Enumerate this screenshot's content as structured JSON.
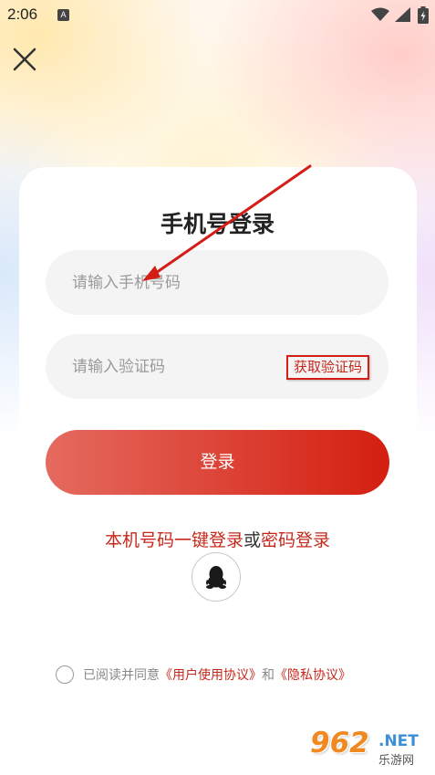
{
  "status_bar": {
    "time": "2:06",
    "notification_icon": "A",
    "icons": [
      "wifi-icon",
      "signal-icon",
      "battery-icon"
    ]
  },
  "header": {
    "close_icon": "close-icon"
  },
  "title": "手机号登录",
  "phone_input": {
    "placeholder": "请输入手机号码",
    "value": ""
  },
  "code_input": {
    "placeholder": "请输入验证码",
    "value": ""
  },
  "get_code_label": "获取验证码",
  "login_button_label": "登录",
  "alt_login": {
    "one_click": "本机号码一键登录",
    "or": "或",
    "password": "密码登录"
  },
  "qq_login_icon": "qq-penguin-icon",
  "agreement": {
    "checked": false,
    "prefix": "已阅读并同意",
    "user_agreement": "《用户使用协议》",
    "and": "和",
    "privacy_agreement": "《隐私协议》"
  },
  "watermark": {
    "number": "962",
    "suffix": ".NET",
    "site": "乐游网"
  },
  "colors": {
    "accent": "#c5291c",
    "button_gradient_start": "#e56a5f",
    "button_gradient_end": "#d41f10",
    "input_bg": "#f4f4f4",
    "annotation": "#d51d17"
  }
}
